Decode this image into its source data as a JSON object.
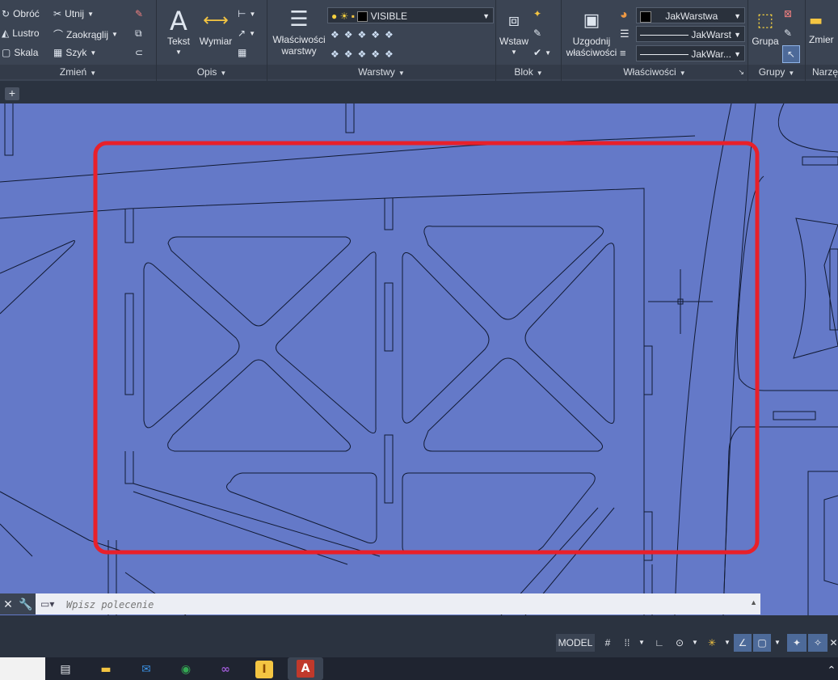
{
  "ribbon": {
    "modify": {
      "title": "Zmień",
      "rotate": "Obróć",
      "trim": "Utnij",
      "mirror": "Lustro",
      "fillet": "Zaokrąglij",
      "scale": "Skala",
      "array": "Szyk"
    },
    "annotation": {
      "title": "Opis",
      "text": "Tekst",
      "dimension": "Wymiar"
    },
    "layers": {
      "title": "Warstwy",
      "properties_line1": "Właściwości",
      "properties_line2": "warstwy",
      "current_layer": "VISIBLE"
    },
    "block": {
      "title": "Blok",
      "insert": "Wstaw"
    },
    "properties": {
      "title": "Właściwości",
      "match_line1": "Uzgodnij",
      "match_line2": "właściwości",
      "color": "JakWarstwa",
      "linetype": "JakWarst",
      "lineweight": "JakWar..."
    },
    "groups": {
      "title": "Grupy",
      "group": "Grupa"
    },
    "utilities": {
      "title": "Narzę",
      "measure": "Zmier"
    }
  },
  "tabs": {
    "add": "+"
  },
  "command": {
    "placeholder": "Wpisz polecenie"
  },
  "status": {
    "model": "MODEL"
  },
  "colors": {
    "canvas": "#6479c8",
    "highlight": "#e8202a",
    "ribbon": "#3b4453"
  }
}
